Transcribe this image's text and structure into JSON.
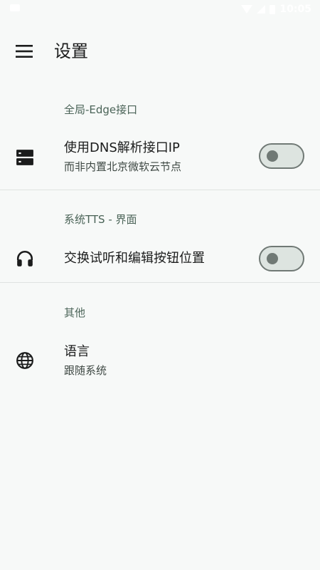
{
  "status_bar": {
    "time": "10:05"
  },
  "app_bar": {
    "menu_icon": "menu-icon",
    "title": "设置"
  },
  "sections": [
    {
      "header": "全局-Edge接口",
      "items": [
        {
          "icon": "dns-server-icon",
          "title": "使用DNS解析接口IP",
          "summary": "而非内置北京微软云节点",
          "switch_on": false
        }
      ]
    },
    {
      "header": "系统TTS - 界面",
      "items": [
        {
          "icon": "headphones-icon",
          "title": "交换试听和编辑按钮位置",
          "switch_on": false
        }
      ]
    },
    {
      "header": "其他",
      "items": [
        {
          "icon": "globe-icon",
          "title": "语言",
          "summary": "跟随系统"
        }
      ]
    }
  ],
  "colors": {
    "background": "#f7f9f8",
    "section_header": "#4a6357",
    "switch_track": "#dde4e0",
    "switch_outline": "#707975"
  }
}
